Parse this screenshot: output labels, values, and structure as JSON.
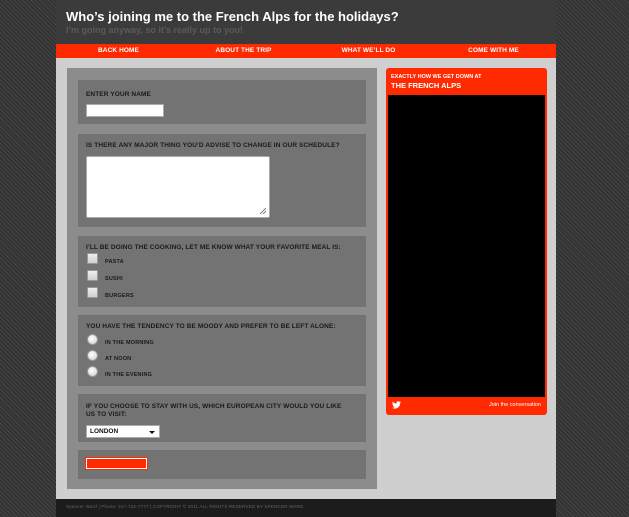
{
  "header": {
    "title": "Who’s joining me to the French Alps for the holidays?",
    "subtitle": "I’m going anyway, so it’s really up to you!"
  },
  "nav": {
    "items": [
      "BACK HOME",
      "ABOUT THE TRIP",
      "WHAT WE’LL DO",
      "COME WITH ME"
    ]
  },
  "form": {
    "name_label": "ENTER YOUR NAME",
    "name_value": "",
    "advice_label": "IS THERE ANY MAJOR THING YOU’D ADVISE TO CHANGE IN OUR SCHEDULE?",
    "advice_value": "",
    "meal_label": "I’LL BE DOING THE COOKING, LET ME KNOW WHAT YOUR FAVORITE MEAL IS:",
    "meal_options": [
      "PASTA",
      "SUSHI",
      "BURGERS"
    ],
    "moody_label": "YOU HAVE THE TENDENCY TO BE MOODY AND PREFER TO BE LEFT ALONE:",
    "moody_options": [
      "IN THE MORNING",
      "AT NOON",
      "IN THE EVENING"
    ],
    "city_label_1": "IF YOU CHOOSE TO STAY WITH US, WHICH EUROPEAN CITY WOULD YOU LIKE",
    "city_label_2": "US TO VISIT:",
    "city_selected": "LONDON"
  },
  "sidebar": {
    "line1": "EXACTLY HOW WE GET DOWN AT",
    "line2": "THE FRENCH ALPS",
    "join_label": "Join the conversation"
  },
  "footer": {
    "text": "Spencer Ward | Phone: 317-722-7777 | COPYRIGHT © 2011 ALL RIGHTS RESERVED BY SPENCER WARD"
  },
  "colors": {
    "accent": "#ff2a00",
    "header_bg": "#3b3b3b",
    "page_bg": "#cfcfcf"
  }
}
